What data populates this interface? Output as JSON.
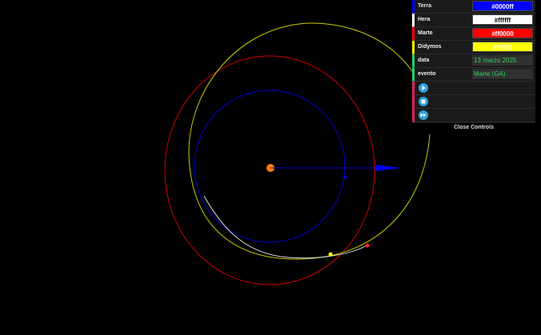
{
  "controls": {
    "colors": [
      {
        "label": "Terra",
        "value": "#0000ff",
        "swatch": "#0000ff",
        "text_color": "#ffffff",
        "bar": "#0000ff"
      },
      {
        "label": "Hera",
        "value": "#ffffff",
        "swatch": "#ffffff",
        "text_color": "#000000",
        "bar": "#ffffff"
      },
      {
        "label": "Marte",
        "value": "#ff0000",
        "swatch": "#ff0000",
        "text_color": "#ffffff",
        "bar": "#ff0000"
      },
      {
        "label": "Didymos",
        "value": "#ffff00",
        "swatch": "#ffff00",
        "text_color": "#ffffff",
        "bar": "#ffff00"
      }
    ],
    "data_label": "data",
    "data_value": "13 marzo 2025",
    "evento_label": "evento",
    "evento_value": "Marte (GA)",
    "buttons": [
      {
        "icon": "play-icon"
      },
      {
        "icon": "stop-icon"
      },
      {
        "icon": "fast-forward-icon"
      }
    ],
    "close_label": "Close Controls"
  }
}
